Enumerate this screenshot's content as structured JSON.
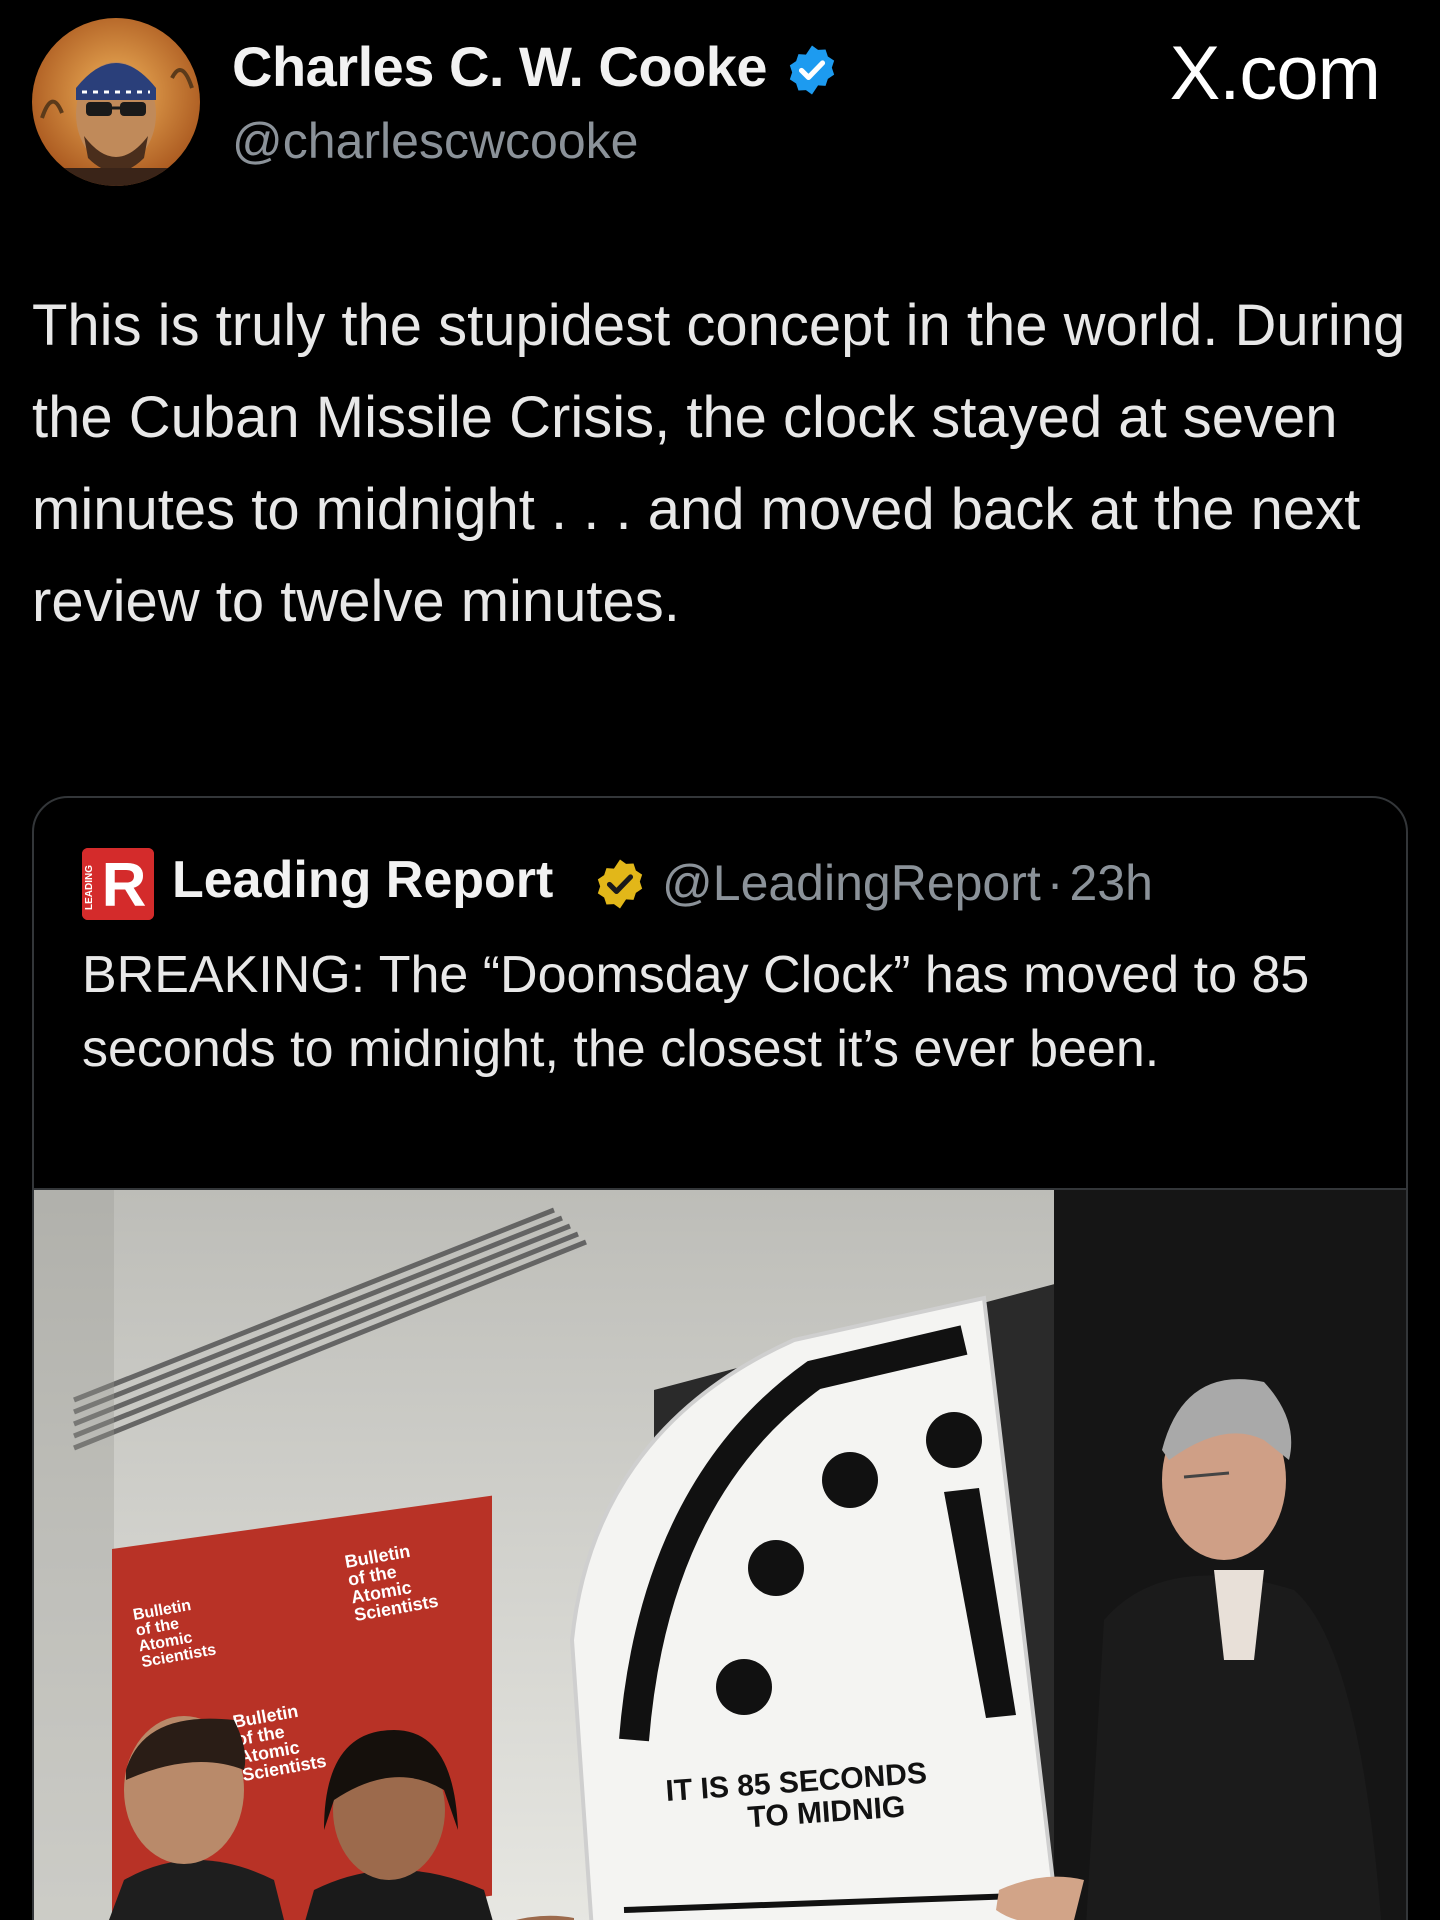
{
  "header": {
    "display_name": "Charles C. W. Cooke",
    "handle": "@charlescwcooke",
    "site_label": "X.com"
  },
  "tweet": {
    "text": "This is truly the stupidest concept in the world. During the Cuban Missile Crisis, the clock stayed at seven minutes to midnight . . . and moved back at the next review to twelve minutes."
  },
  "quoted": {
    "logo_letter": "R",
    "logo_side_text": "LEADING",
    "name": "Leading Report",
    "handle": "@LeadingReport",
    "separator": "·",
    "time": "23h",
    "text": "BREAKING: The “Doomsday Clock” has moved to 85 seconds to midnight, the closest it’s ever been."
  },
  "photo": {
    "banner_text": [
      "Bulletin",
      "of the",
      "Atomic",
      "Scientists"
    ],
    "clock_caption_line1": "IT IS 85 SECONDS",
    "clock_caption_line2": "TO MIDNIG"
  },
  "colors": {
    "background": "#000000",
    "text": "#e7e9ea",
    "secondary_text": "#8b9299",
    "verified_blue": "#1d9bf0",
    "verified_gold": "#e2b719",
    "logo_red": "#d42b2b",
    "card_border": "#333639"
  },
  "icons": {
    "verified": "verified-badge-icon",
    "org_verified": "gold-verified-badge-icon"
  }
}
